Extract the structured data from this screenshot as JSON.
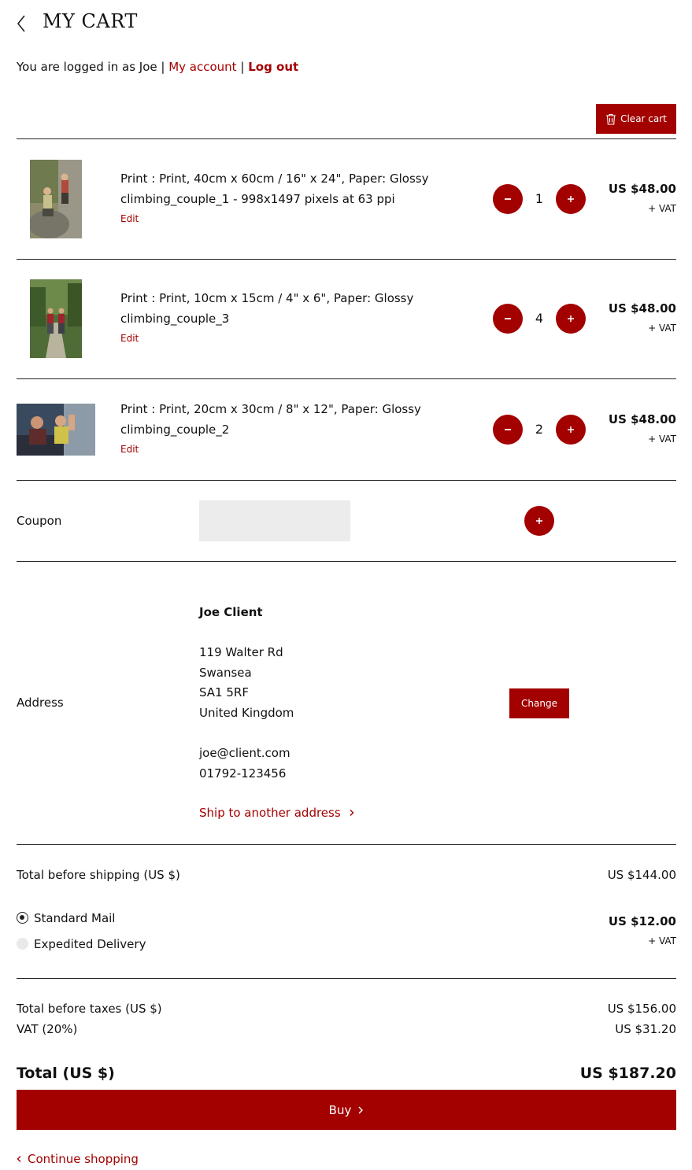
{
  "header": {
    "title": "MY CART",
    "back_icon": "chevron-left-icon"
  },
  "account": {
    "prefix": "You are logged in as Joe |",
    "my_account": "My account",
    "separator": "|",
    "logout": "Log out"
  },
  "toolbar": {
    "clear_cart": "Clear cart",
    "clear_icon": "trash-icon"
  },
  "items": [
    {
      "line1": "Print : Print, 40cm x 60cm / 16\" x 24\", Paper: Glossy",
      "line2": "climbing_couple_1 - 998x1497 pixels at 63 ppi",
      "edit": "Edit",
      "quantity": "1",
      "price": "US $48.00",
      "vat": "+ VAT"
    },
    {
      "line1": "Print : Print, 10cm x 15cm / 4\" x 6\", Paper: Glossy",
      "line2": "climbing_couple_3",
      "edit": "Edit",
      "quantity": "4",
      "price": "US $48.00",
      "vat": "+ VAT"
    },
    {
      "line1": "Print : Print, 20cm x 30cm / 8\" x 12\", Paper: Glossy",
      "line2": "climbing_couple_2",
      "edit": "Edit",
      "quantity": "2",
      "price": "US $48.00",
      "vat": "+ VAT"
    }
  ],
  "coupon": {
    "label": "Coupon",
    "value": "",
    "placeholder": ""
  },
  "address": {
    "label": "Address",
    "name": "Joe Client",
    "street": "119 Walter Rd",
    "city": "Swansea",
    "postcode": "SA1 5RF",
    "country": "United Kingdom",
    "email": "joe@client.com",
    "phone": "01792-123456",
    "ship_another": "Ship to another address",
    "change": "Change"
  },
  "shipping": {
    "total_before_shipping_label": "Total before shipping (US $)",
    "total_before_shipping_value": "US $144.00",
    "options": [
      {
        "label": "Standard Mail",
        "selected": true
      },
      {
        "label": "Expedited Delivery",
        "selected": false
      }
    ],
    "price": "US $12.00",
    "vat": "+ VAT"
  },
  "totals": {
    "before_taxes_label": "Total before taxes (US $)",
    "before_taxes_value": "US $156.00",
    "vat_label": "VAT (20%)",
    "vat_value": "US $31.20",
    "total_label": "Total (US $)",
    "total_value": "US $187.20"
  },
  "actions": {
    "buy": "Buy",
    "continue": "Continue shopping"
  },
  "colors": {
    "accent": "#a30000",
    "input_bg": "#ececec"
  }
}
